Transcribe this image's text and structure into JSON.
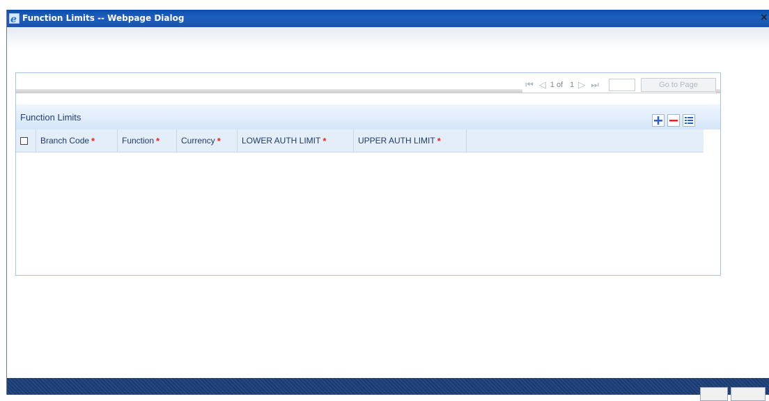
{
  "window": {
    "title": "Function Limits -- Webpage Dialog",
    "close_glyph": "×"
  },
  "pager": {
    "first_icon": "first-page-icon",
    "prev_icon": "previous-page-icon",
    "page_text": "1 of",
    "total_pages": "1",
    "next_icon": "next-page-icon",
    "last_icon": "last-page-icon",
    "page_value": "",
    "goto_label": "Go to Page"
  },
  "section": {
    "title": "Function Limits",
    "toolbar": [
      {
        "name": "add-row-icon",
        "glyph": "+"
      },
      {
        "name": "delete-row-icon",
        "glyph": "−"
      },
      {
        "name": "single-view-icon",
        "glyph": "☰"
      }
    ]
  },
  "grid": {
    "columns": [
      {
        "label": "Branch Code",
        "required": "*"
      },
      {
        "label": "Function",
        "required": "*"
      },
      {
        "label": "Currency",
        "required": "*"
      },
      {
        "label": "LOWER AUTH LIMIT",
        "required": "*"
      },
      {
        "label": "UPPER AUTH LIMIT",
        "required": "*"
      }
    ],
    "rows": []
  },
  "colors": {
    "titlebar": "#1a56b0",
    "section_text": "#1f3f74",
    "required": "#e22222",
    "footer": "#1b3a70"
  }
}
